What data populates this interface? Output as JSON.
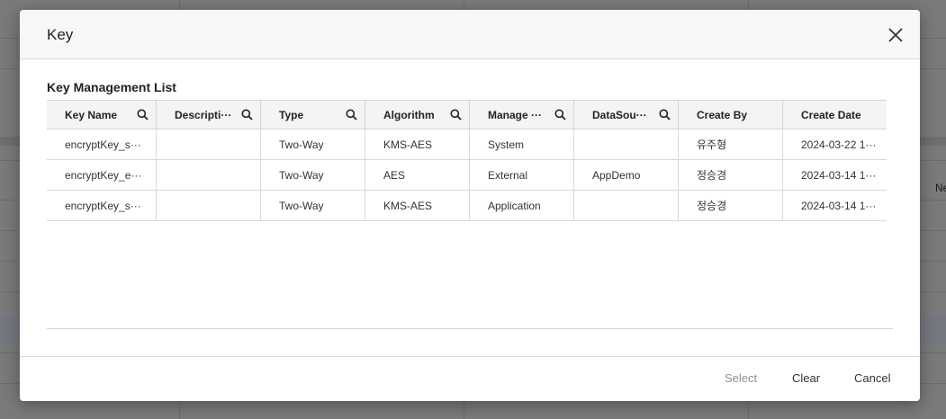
{
  "background": {
    "partial_text": "Ne"
  },
  "modal": {
    "title": "Key",
    "list_title": "Key Management List",
    "columns": [
      {
        "label": "Key Name",
        "searchable": true
      },
      {
        "label": "Descripti···",
        "searchable": true
      },
      {
        "label": "Type",
        "searchable": true
      },
      {
        "label": "Algorithm",
        "searchable": true
      },
      {
        "label": "Manage ···",
        "searchable": true
      },
      {
        "label": "DataSou···",
        "searchable": true
      },
      {
        "label": "Create By",
        "searchable": false
      },
      {
        "label": "Create Date",
        "searchable": false
      }
    ],
    "rows": [
      [
        "encryptKey_s···",
        "",
        "Two-Way",
        "KMS-AES",
        "System",
        "",
        "유주형",
        "2024-03-22 1···"
      ],
      [
        "encryptKey_e···",
        "",
        "Two-Way",
        "AES",
        "External",
        "AppDemo",
        "정승경",
        "2024-03-14 1···"
      ],
      [
        "encryptKey_s···",
        "",
        "Two-Way",
        "KMS-AES",
        "Application",
        "",
        "정승경",
        "2024-03-14 1···"
      ]
    ],
    "footer": {
      "select_label": "Select",
      "clear_label": "Clear",
      "cancel_label": "Cancel"
    }
  },
  "icons": {
    "close": "close-icon",
    "search": "search-icon"
  },
  "colors": {
    "overlay": "#7a7a7a",
    "header_bg": "#f7f7f7",
    "disabled_text": "#8e8e8e"
  }
}
